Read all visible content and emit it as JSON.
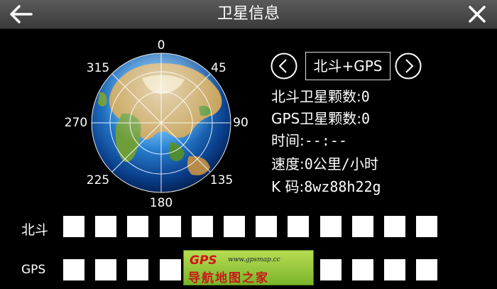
{
  "titlebar": {
    "title": "卫星信息"
  },
  "compass": {
    "degrees": {
      "d0": "0",
      "d45": "45",
      "d90": "90",
      "d135": "135",
      "d180": "180",
      "d225": "225",
      "d270": "270",
      "d315": "315"
    }
  },
  "mode": {
    "label": "北斗+GPS"
  },
  "info": {
    "beidou_count_label": "北斗卫星颗数:",
    "beidou_count": "0",
    "gps_count_label": "GPS卫星颗数:",
    "gps_count": "0",
    "time_label": "时间:",
    "time_value": "--:--",
    "speed_label": "速度:",
    "speed_value": "0公里/小时",
    "k_label": "K 码:",
    "k_value": "8wz88h22g"
  },
  "rows": {
    "beidou_label": "北斗",
    "gps_label": "GPS"
  },
  "watermark": {
    "logo": "GPS",
    "url": "www.gpsmap.cc",
    "name": "导航地图之家"
  },
  "colors": {
    "titlebar": "#4a4a4a",
    "background": "#000000",
    "slot": "#ffffff",
    "watermark": "#9acd3f"
  }
}
